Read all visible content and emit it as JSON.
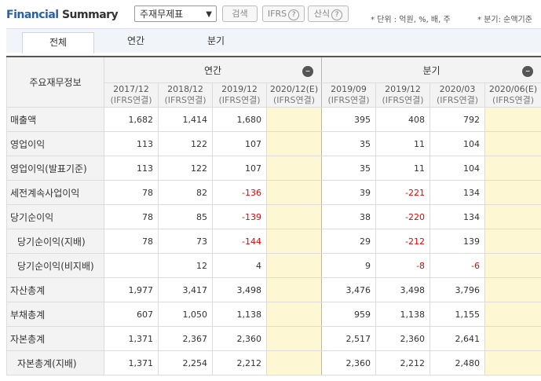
{
  "header": {
    "title_part1": "Financial",
    "title_part2": " Summary",
    "select_value": "주재무제표",
    "search_label": "검색",
    "ifrs_label": "IFRS",
    "formula_label": "산식",
    "unit_note": "* 단위 : 억원, %, 배, 주",
    "period_note": "* 분기: 순액기준"
  },
  "tabs": [
    "전체",
    "연간",
    "분기"
  ],
  "table": {
    "row_header": "주요재무정보",
    "group_annual": "연간",
    "group_quarter": "분기",
    "sub": "(IFRS연결)",
    "columns": [
      "2017/12",
      "2018/12",
      "2019/12",
      "2020/12(E)",
      "2019/09",
      "2019/12",
      "2020/03",
      "2020/06(E)"
    ],
    "rows": [
      {
        "label": "매출액",
        "values": [
          "1,682",
          "1,414",
          "1,680",
          "",
          "395",
          "408",
          "792",
          ""
        ]
      },
      {
        "label": "영업이익",
        "values": [
          "113",
          "122",
          "107",
          "",
          "35",
          "11",
          "104",
          ""
        ]
      },
      {
        "label": "영업이익(발표기준)",
        "values": [
          "113",
          "122",
          "107",
          "",
          "35",
          "11",
          "104",
          ""
        ]
      },
      {
        "label": "세전계속사업이익",
        "values": [
          "78",
          "82",
          "-136",
          "",
          "39",
          "-221",
          "134",
          ""
        ]
      },
      {
        "label": "당기순이익",
        "values": [
          "78",
          "85",
          "-139",
          "",
          "38",
          "-220",
          "134",
          ""
        ]
      },
      {
        "label": "당기순이익(지배)",
        "values": [
          "78",
          "73",
          "-144",
          "",
          "29",
          "-212",
          "139",
          ""
        ]
      },
      {
        "label": "당기순이익(비지배)",
        "values": [
          "",
          "12",
          "4",
          "",
          "9",
          "-8",
          "-6",
          ""
        ]
      },
      {
        "label": "자산총계",
        "values": [
          "1,977",
          "3,417",
          "3,498",
          "",
          "3,476",
          "3,498",
          "3,796",
          ""
        ]
      },
      {
        "label": "부채총계",
        "values": [
          "607",
          "1,050",
          "1,138",
          "",
          "959",
          "1,138",
          "1,155",
          ""
        ]
      },
      {
        "label": "자본총계",
        "values": [
          "1,371",
          "2,367",
          "2,360",
          "",
          "2,517",
          "2,360",
          "2,641",
          ""
        ]
      },
      {
        "label": "자본총계(지배)",
        "values": [
          "1,371",
          "2,254",
          "2,212",
          "",
          "2,360",
          "2,212",
          "2,480",
          ""
        ]
      }
    ]
  }
}
